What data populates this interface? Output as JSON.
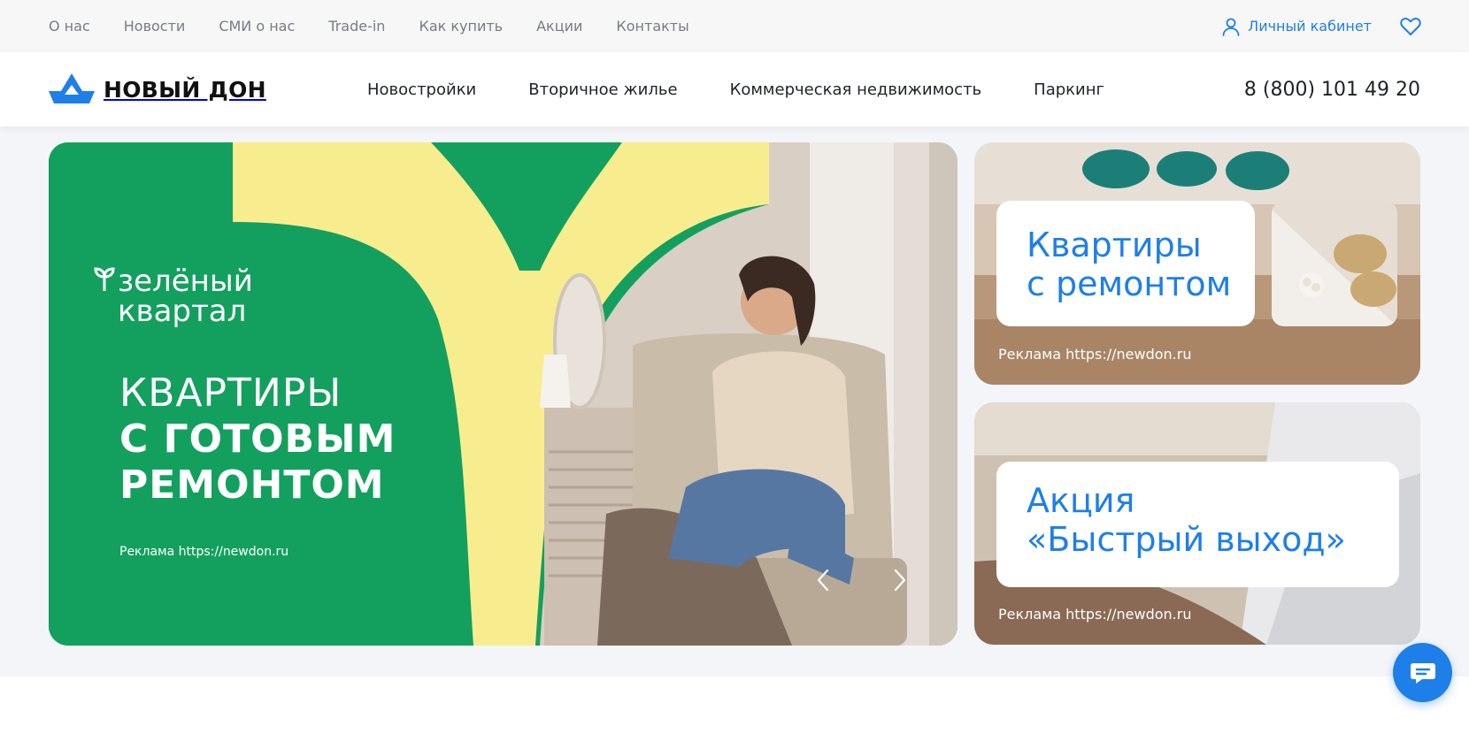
{
  "topbar": {
    "links": [
      "О нас",
      "Новости",
      "СМИ о нас",
      "Trade-in",
      "Как купить",
      "Акции",
      "Контакты"
    ],
    "cabinet_label": "Личный кабинет"
  },
  "header": {
    "logo_text": "НОВЫЙ ДОН",
    "nav": [
      "Новостройки",
      "Вторичное жилье",
      "Коммерческая недвижимость",
      "Паркинг"
    ],
    "phone": "8 (800) 101 49 20"
  },
  "slider": {
    "brand_line1": "зелёный",
    "brand_line2": "квартал",
    "title_line1": "КВАРТИРЫ",
    "title_line2": "С ГОТОВЫМ",
    "title_line3": "РЕМОНТОМ",
    "ad": "Реклама https://newdon.ru"
  },
  "cards": [
    {
      "line1": "Квартиры",
      "line2": "с ремонтом",
      "ad": "Реклама https://newdon.ru"
    },
    {
      "line1": "Акция",
      "line2": "«Быстрый выход»",
      "ad": "Реклама https://newdon.ru"
    }
  ],
  "colors": {
    "accent": "#1e7fe8",
    "green": "#13a05e",
    "yellow": "#f8ed8e"
  }
}
